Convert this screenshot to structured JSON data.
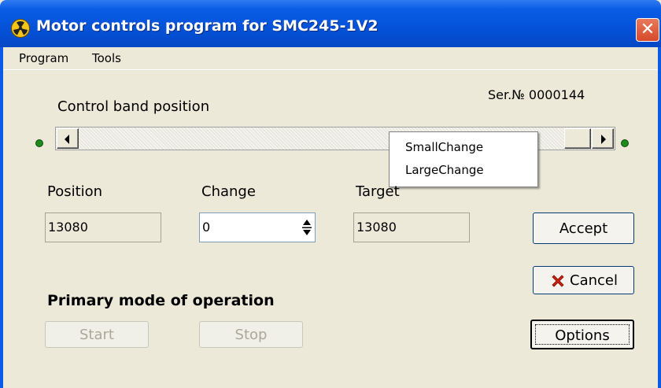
{
  "window": {
    "title": "Motor controls program for SMC245-1V2",
    "close_glyph": "✕"
  },
  "menu": {
    "items": [
      "Program",
      "Tools"
    ]
  },
  "serial_label": "Ser.№ 0000144",
  "control_band": {
    "label": "Control band position",
    "scroll_left_icon": "arrow-left",
    "scroll_right_icon": "arrow-right",
    "indicator_color": "#1e8a1e"
  },
  "context_menu": {
    "items": [
      "SmallChange",
      "LargeChange"
    ]
  },
  "fields": {
    "position": {
      "label": "Position",
      "value": "13080"
    },
    "change": {
      "label": "Change",
      "value": "0"
    },
    "target": {
      "label": "Target",
      "value": "13080"
    }
  },
  "buttons": {
    "accept": "Accept",
    "cancel": "Cancel",
    "options": "Options",
    "start": "Start",
    "stop": "Stop"
  },
  "primary_mode": {
    "heading": "Primary mode of operation"
  },
  "colors": {
    "titlebar": "#0552d8",
    "cancel_icon": "#d02010",
    "window_bg": "#ece9d8"
  }
}
